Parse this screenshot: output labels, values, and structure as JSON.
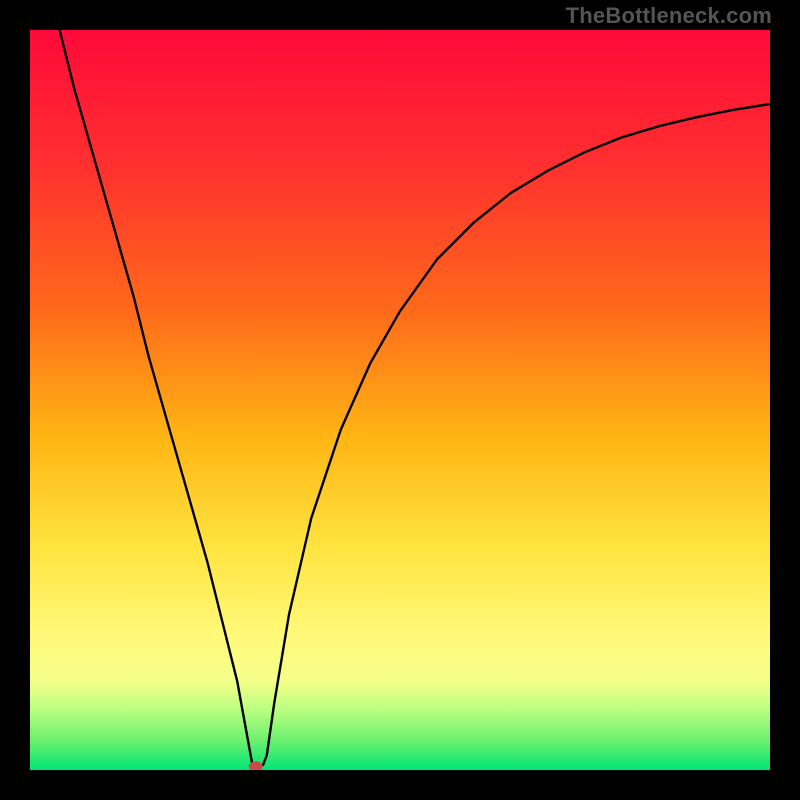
{
  "watermark": "TheBottleneck.com",
  "chart_data": {
    "type": "line",
    "title": "",
    "xlabel": "",
    "ylabel": "",
    "xlim": [
      0,
      100
    ],
    "ylim": [
      0,
      100
    ],
    "series": [
      {
        "name": "bottleneck-curve",
        "x": [
          4,
          6,
          8,
          10,
          12,
          14,
          16,
          18,
          20,
          22,
          24,
          26,
          28,
          30,
          30.5,
          31,
          31.5,
          32,
          33,
          35,
          38,
          42,
          46,
          50,
          55,
          60,
          65,
          70,
          75,
          80,
          85,
          90,
          95,
          100
        ],
        "y": [
          100,
          92,
          85,
          78,
          71,
          64,
          56,
          49,
          42,
          35,
          28,
          20,
          12,
          1,
          0.5,
          0.6,
          0.7,
          2,
          9,
          21,
          34,
          46,
          55,
          62,
          69,
          74,
          78,
          81,
          83.5,
          85.5,
          87,
          88.2,
          89.2,
          90
        ]
      }
    ],
    "marker": {
      "x": 30.5,
      "y": 0.5,
      "color": "#cc4a4a"
    },
    "background_gradient": [
      "#ff0a3a",
      "#ffb514",
      "#ffe440",
      "#00e676"
    ]
  }
}
